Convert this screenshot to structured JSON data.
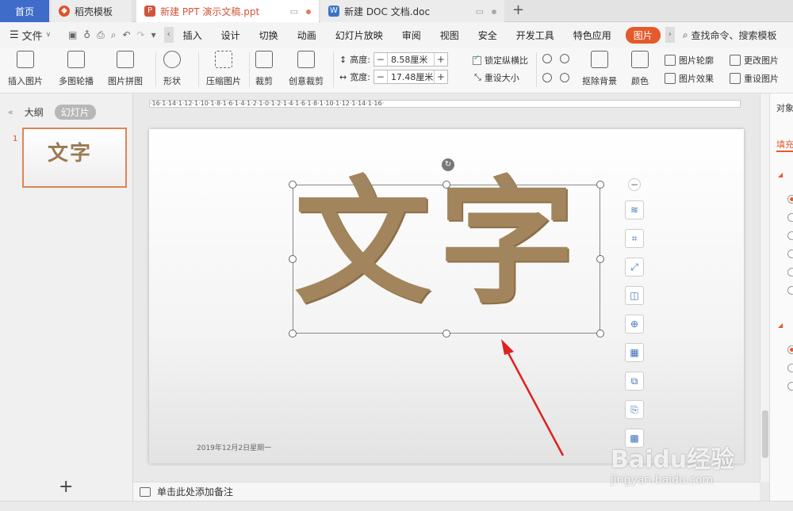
{
  "tabs": {
    "home": "首页",
    "template": "稻壳模板",
    "ppt": "新建 PPT 演示文稿.ppt",
    "doc": "新建 DOC 文档.doc"
  },
  "menu": {
    "file": "文件",
    "items": [
      "插入",
      "设计",
      "切换",
      "动画",
      "幻灯片放映",
      "审阅",
      "视图",
      "安全",
      "开发工具",
      "特色应用"
    ],
    "active": "图片",
    "search": "查找命令、搜索模板"
  },
  "ribbon": {
    "insert_picture": "插入图片",
    "multi_outline": "多图轮播",
    "picture_collage": "图片拼图",
    "shape": "形状",
    "compress": "压缩图片",
    "crop": "裁剪",
    "creative_crop": "创意裁剪",
    "height_label": "高度:",
    "height_value": "8.58厘米",
    "width_label": "宽度:",
    "width_value": "17.48厘米",
    "lock_ratio": "锁定纵横比",
    "reset_size": "重设大小",
    "remove_bg": "抠除背景",
    "color": "颜色",
    "pic_outline": "图片轮廓",
    "pic_effect": "图片效果",
    "change_pic": "更改图片",
    "reset_pic": "重设图片"
  },
  "left_panel": {
    "outline": "大纲",
    "slides": "幻灯片",
    "slide_number": "1",
    "thumb_text": "文字"
  },
  "slide": {
    "main_text": "文字",
    "date": "2019年12月2日星期一"
  },
  "ruler": "·16·1·14·1·12·1·10·1·8·1·6·1·4·1·2·1·0·1·2·1·4·1·6·1·8·1·10·1·12·1·14·1·16·",
  "right_panel": {
    "title": "对象",
    "tab": "填充"
  },
  "notes": "单击此处添加备注",
  "watermark": {
    "brand": "Baidu经验",
    "url": "jingyan.baidu.com"
  },
  "colors": {
    "accent": "#e55a2b",
    "home_tab": "#3f6bc9",
    "arrow": "#e02020",
    "text_fill": "#a2855c"
  }
}
